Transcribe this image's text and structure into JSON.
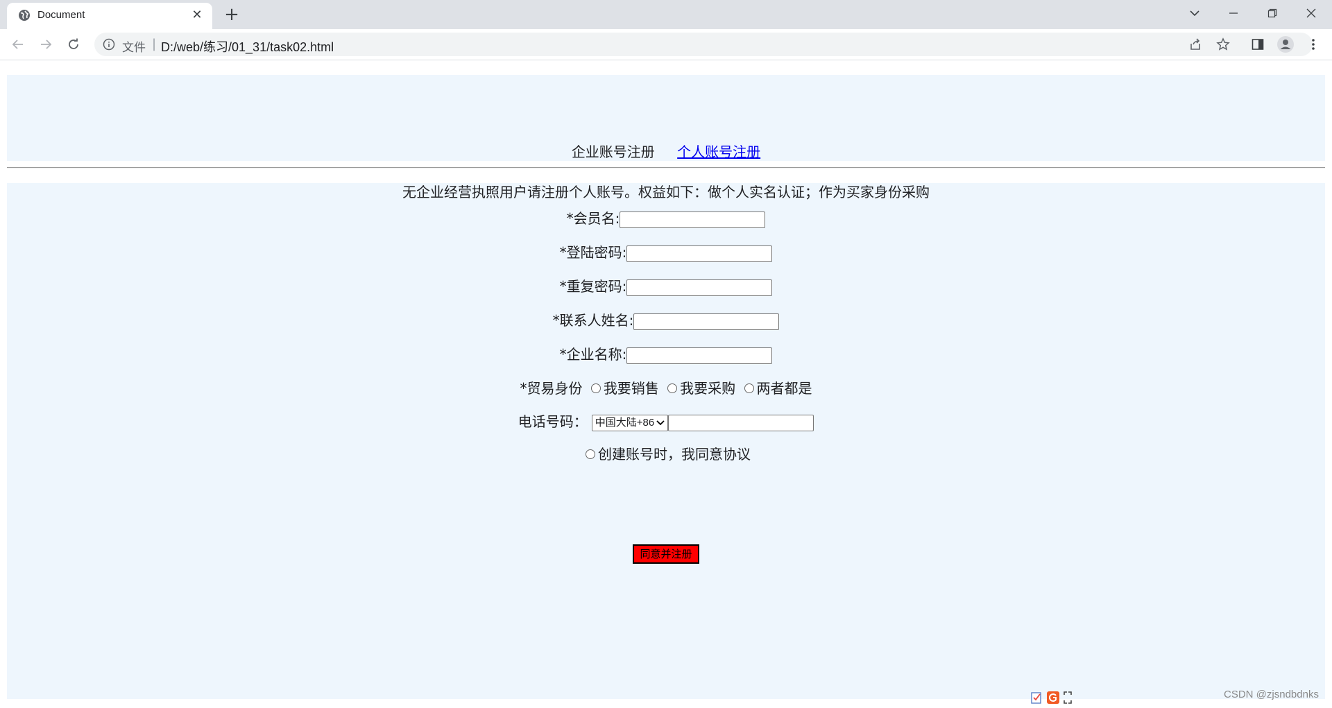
{
  "browser": {
    "tab_title": "Document",
    "tab_close": "✕",
    "new_tab": "+",
    "scheme_label": "文件",
    "url_separator": "|",
    "url": "D:/web/练习/01_31/task02.html"
  },
  "header": {
    "company_label": "企业账号注册",
    "personal_link": "个人账号注册"
  },
  "form": {
    "intro": "无企业经营执照用户请注册个人账号。权益如下：做个人实名认证；作为买家身份采购",
    "member_name_label": "*会员名:",
    "member_name_value": "",
    "password_label": "*登陆密码:",
    "password_value": "",
    "repeat_password_label": "*重复密码:",
    "repeat_password_value": "",
    "contact_name_label": "*联系人姓名:",
    "contact_name_value": "",
    "company_name_label": "*企业名称:",
    "company_name_value": "",
    "trade_identity_label": "*贸易身份",
    "trade_options": [
      "我要销售",
      "我要采购",
      "两者都是"
    ],
    "phone_label": "电话号码：",
    "phone_region_selected": "中国大陆+86",
    "phone_value": "",
    "agreement_label": "创建账号时，我同意协议",
    "submit_label": "同意并注册"
  },
  "watermark": "CSDN @zjsndbdnks",
  "colors": {
    "panel_bg": "#eef6fd",
    "submit_bg": "#ff0000",
    "link": "#0000ee",
    "tabstrip": "#dee1e6"
  }
}
